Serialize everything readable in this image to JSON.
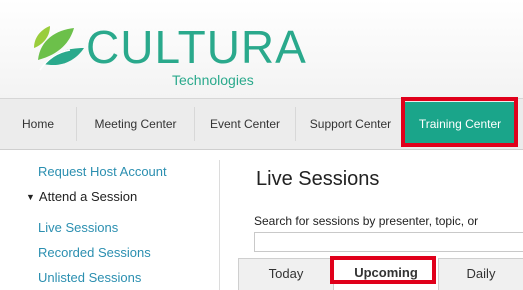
{
  "brand": {
    "name": "CULTURA",
    "tagline": "Technologies",
    "color": "#2aa98c"
  },
  "nav": {
    "items": [
      {
        "label": "Home"
      },
      {
        "label": "Meeting Center"
      },
      {
        "label": "Event Center"
      },
      {
        "label": "Support Center"
      },
      {
        "label": "Training Center",
        "active": true
      }
    ],
    "active_color": "#1aa58a"
  },
  "sidebar": {
    "request_host": "Request Host Account",
    "attend_heading": "Attend a Session",
    "items": [
      {
        "label": "Live Sessions"
      },
      {
        "label": "Recorded Sessions"
      },
      {
        "label": "Unlisted Sessions"
      }
    ],
    "link_color": "#2b8fb0"
  },
  "main": {
    "title": "Live Sessions",
    "search_label": "Search for sessions by presenter, topic, or",
    "search_value": "",
    "tabs": [
      {
        "label": "Today"
      },
      {
        "label": "Upcoming",
        "active": true
      },
      {
        "label": "Daily"
      }
    ]
  },
  "highlight_color": "#e0001b"
}
